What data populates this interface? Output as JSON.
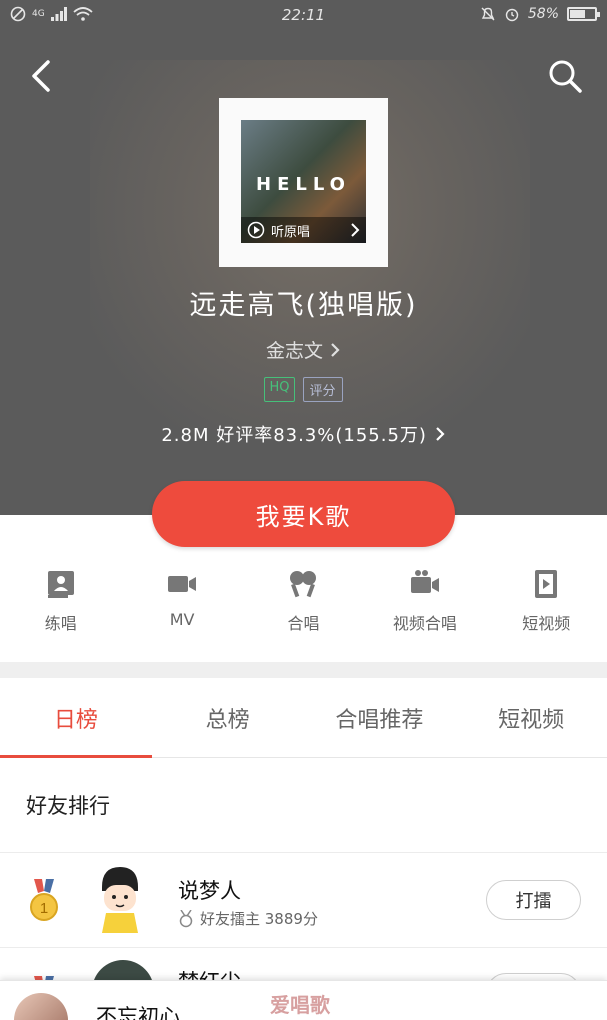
{
  "status_bar": {
    "network": "4G",
    "time": "22:11",
    "battery": "58%",
    "battery_level": 0.58
  },
  "hero": {
    "cover_text": "HELLO",
    "cover_listen_label": "听原唱",
    "song_title": "远走高飞(独唱版)",
    "artist": "金志文",
    "badge_hq": "HQ",
    "badge_score": "评分",
    "stats": "2.8M 好评率83.3%(155.5万)",
    "k_song_button": "我要K歌"
  },
  "features": [
    {
      "label": "练唱",
      "icon": "practice-icon"
    },
    {
      "label": "MV",
      "icon": "video-camera-icon"
    },
    {
      "label": "合唱",
      "icon": "chorus-icon"
    },
    {
      "label": "视频合唱",
      "icon": "video-chorus-icon"
    },
    {
      "label": "短视频",
      "icon": "short-video-icon"
    }
  ],
  "tabs": [
    {
      "label": "日榜",
      "active": true
    },
    {
      "label": "总榜",
      "active": false
    },
    {
      "label": "合唱推荐",
      "active": false
    },
    {
      "label": "短视频",
      "active": false
    }
  ],
  "friends_rank": {
    "title": "好友排行",
    "rows": [
      {
        "rank": "1",
        "name": "说梦人",
        "sub": "好友擂主 3889分",
        "button": "打擂"
      },
      {
        "name": "梦红尘"
      }
    ]
  },
  "player": {
    "title": "不忘初心",
    "watermark": "爱唱歌"
  },
  "colors": {
    "accent": "#ee4b3d",
    "hq_green": "#46c07a",
    "hero_bg": "#5b5b5b"
  }
}
